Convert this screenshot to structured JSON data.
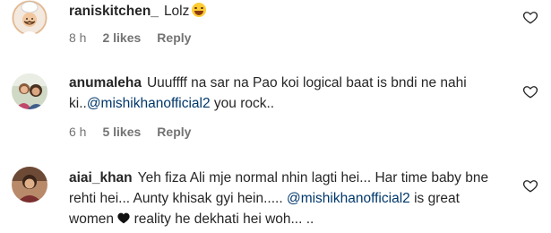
{
  "comments": [
    {
      "username": "raniskitchen_",
      "text": "Lolz",
      "emoji_icon": "laughing-emoji",
      "time": "8 h",
      "likes": "2 likes",
      "reply": "Reply",
      "avatar_icon": "chef-avatar"
    },
    {
      "username": "anumaleha",
      "text_before": "Uuuffff na sar na Pao koi logical baat is bndi ne nahi ki..",
      "mention": "@mishikhanofficial2",
      "text_after": " you rock..",
      "time": "6 h",
      "likes": "5 likes",
      "reply": "Reply",
      "avatar_icon": "photo-avatar"
    },
    {
      "username": "aiai_khan",
      "text_before": "Yeh fiza Ali mje normal nhin lagti hei... Har time baby bne rehti hei... Aunty khisak gyi hein..... ",
      "mention": "@mishikhanofficial2",
      "text_middle": " is great women ",
      "heart_icon": "black-heart-emoji",
      "text_after": " reality he dekhati hei woh... ..",
      "avatar_icon": "photo-avatar"
    }
  ],
  "colors": {
    "mention": "#00376b",
    "meta": "#737373",
    "text": "#262626"
  }
}
